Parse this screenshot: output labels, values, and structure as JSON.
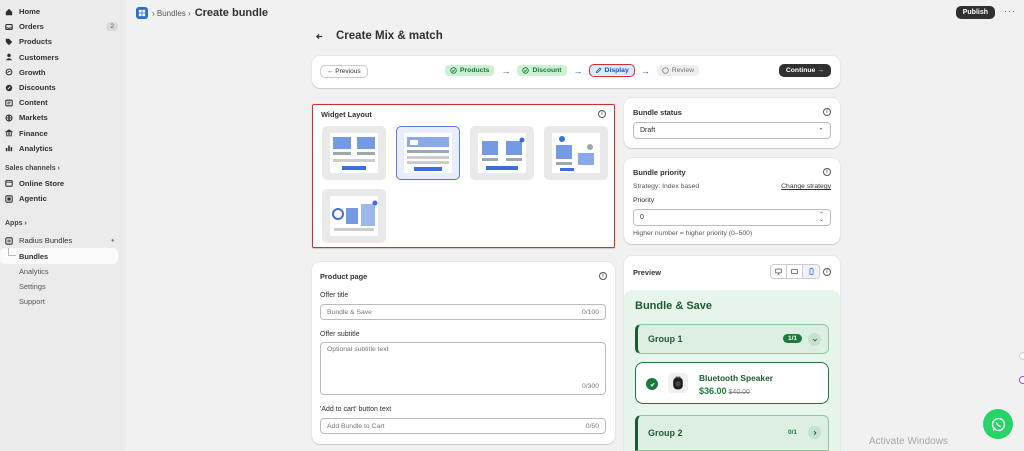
{
  "sidebar": {
    "items": [
      {
        "label": "Home",
        "icon": "home-icon"
      },
      {
        "label": "Orders",
        "icon": "inbox-icon",
        "badge": "2"
      },
      {
        "label": "Products",
        "icon": "tag-icon"
      },
      {
        "label": "Customers",
        "icon": "person-icon"
      },
      {
        "label": "Growth",
        "icon": "growth-icon"
      },
      {
        "label": "Discounts",
        "icon": "discount-icon"
      },
      {
        "label": "Content",
        "icon": "content-icon"
      },
      {
        "label": "Markets",
        "icon": "globe-icon"
      },
      {
        "label": "Finance",
        "icon": "bank-icon"
      },
      {
        "label": "Analytics",
        "icon": "bar-chart-icon"
      }
    ],
    "sales_channels_label": "Sales channels ›",
    "channels": [
      {
        "label": "Online Store",
        "icon": "store-icon"
      },
      {
        "label": "Agentic",
        "icon": "agentic-icon"
      }
    ],
    "apps_label": "Apps ›",
    "app": {
      "label": "Radius Bundles",
      "more": "•"
    },
    "app_sub": [
      "Bundles",
      "Analytics",
      "Settings",
      "Support"
    ]
  },
  "topbar": {
    "crumb": "› Bundles ›",
    "title": "Create bundle",
    "publish": "Publish",
    "more": "···"
  },
  "page": {
    "title": "Create Mix & match"
  },
  "stepper": {
    "previous": "← Previous",
    "steps": [
      "Products",
      "Discount",
      "Display",
      "Review"
    ],
    "continue": "Continue →"
  },
  "widget": {
    "title": "Widget Layout"
  },
  "product_page": {
    "title": "Product page",
    "offer_title_label": "Offer title",
    "offer_title_value": "Bundle & Save",
    "offer_title_count": "0/100",
    "offer_subtitle_label": "Offer subtitle",
    "offer_subtitle_placeholder": "Optional subtitle text",
    "offer_subtitle_count": "0/300",
    "cart_label": "'Add to cart' button text",
    "cart_value": "Add Bundle to Cart",
    "cart_count": "0/50"
  },
  "status": {
    "title": "Bundle status",
    "value": "Draft"
  },
  "priority": {
    "title": "Bundle priority",
    "strategy": "Strategy: Index based",
    "change": "Change strategy",
    "label": "Priority",
    "value": "0",
    "help": "Higher number = higher priority (0–500)"
  },
  "preview": {
    "title": "Preview",
    "heading": "Bundle & Save",
    "group1": {
      "name": "Group 1",
      "badge": "1/1"
    },
    "item": {
      "name": "Bluetooth Speaker",
      "price": "$36.00",
      "compare": "$40.00"
    },
    "group2": {
      "name": "Group 2",
      "badge": "0/1"
    }
  },
  "watermark": "Activate Windows",
  "colors": {
    "accent_green": "#1a7a3a",
    "highlight_red": "#d32f2f",
    "brand_blue": "#2c6ecb"
  }
}
